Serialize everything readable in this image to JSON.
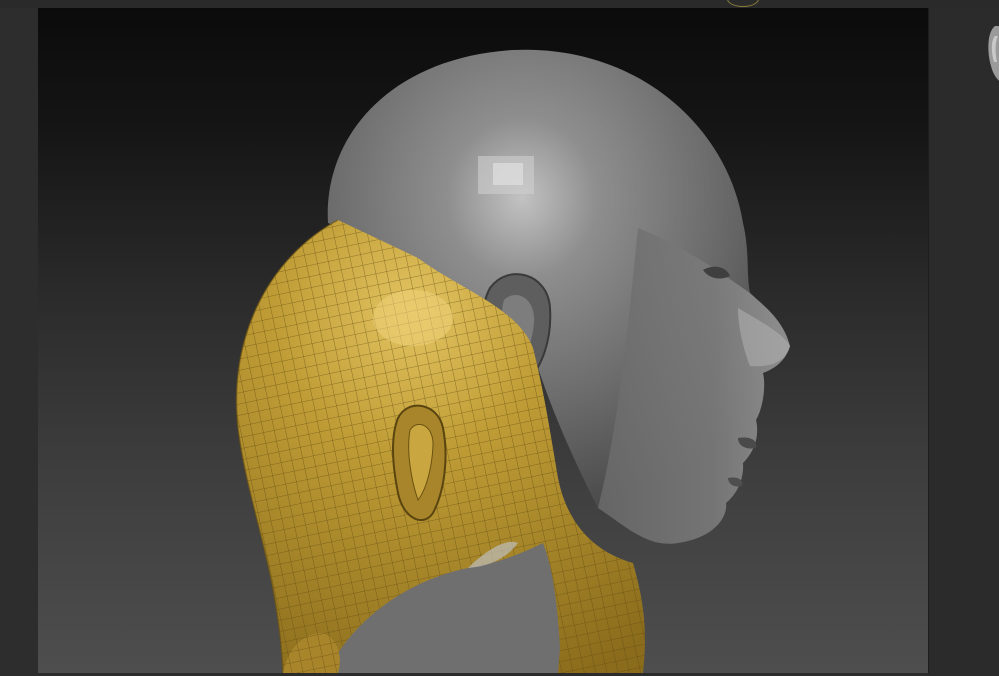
{
  "app": {
    "title": ""
  },
  "viewport": {
    "model_name": "",
    "background_top": "#0b0b0b",
    "background_bottom": "#4e4e4e",
    "model_gray": "#7a7a7a",
    "polypaint_gold": "#b8972e",
    "wire_color": "#5c4610"
  },
  "icons": {
    "head_model": "head-model-icon",
    "thumbnail": "model-thumbnail-icon",
    "top_indicator": "circle-indicator-icon"
  }
}
